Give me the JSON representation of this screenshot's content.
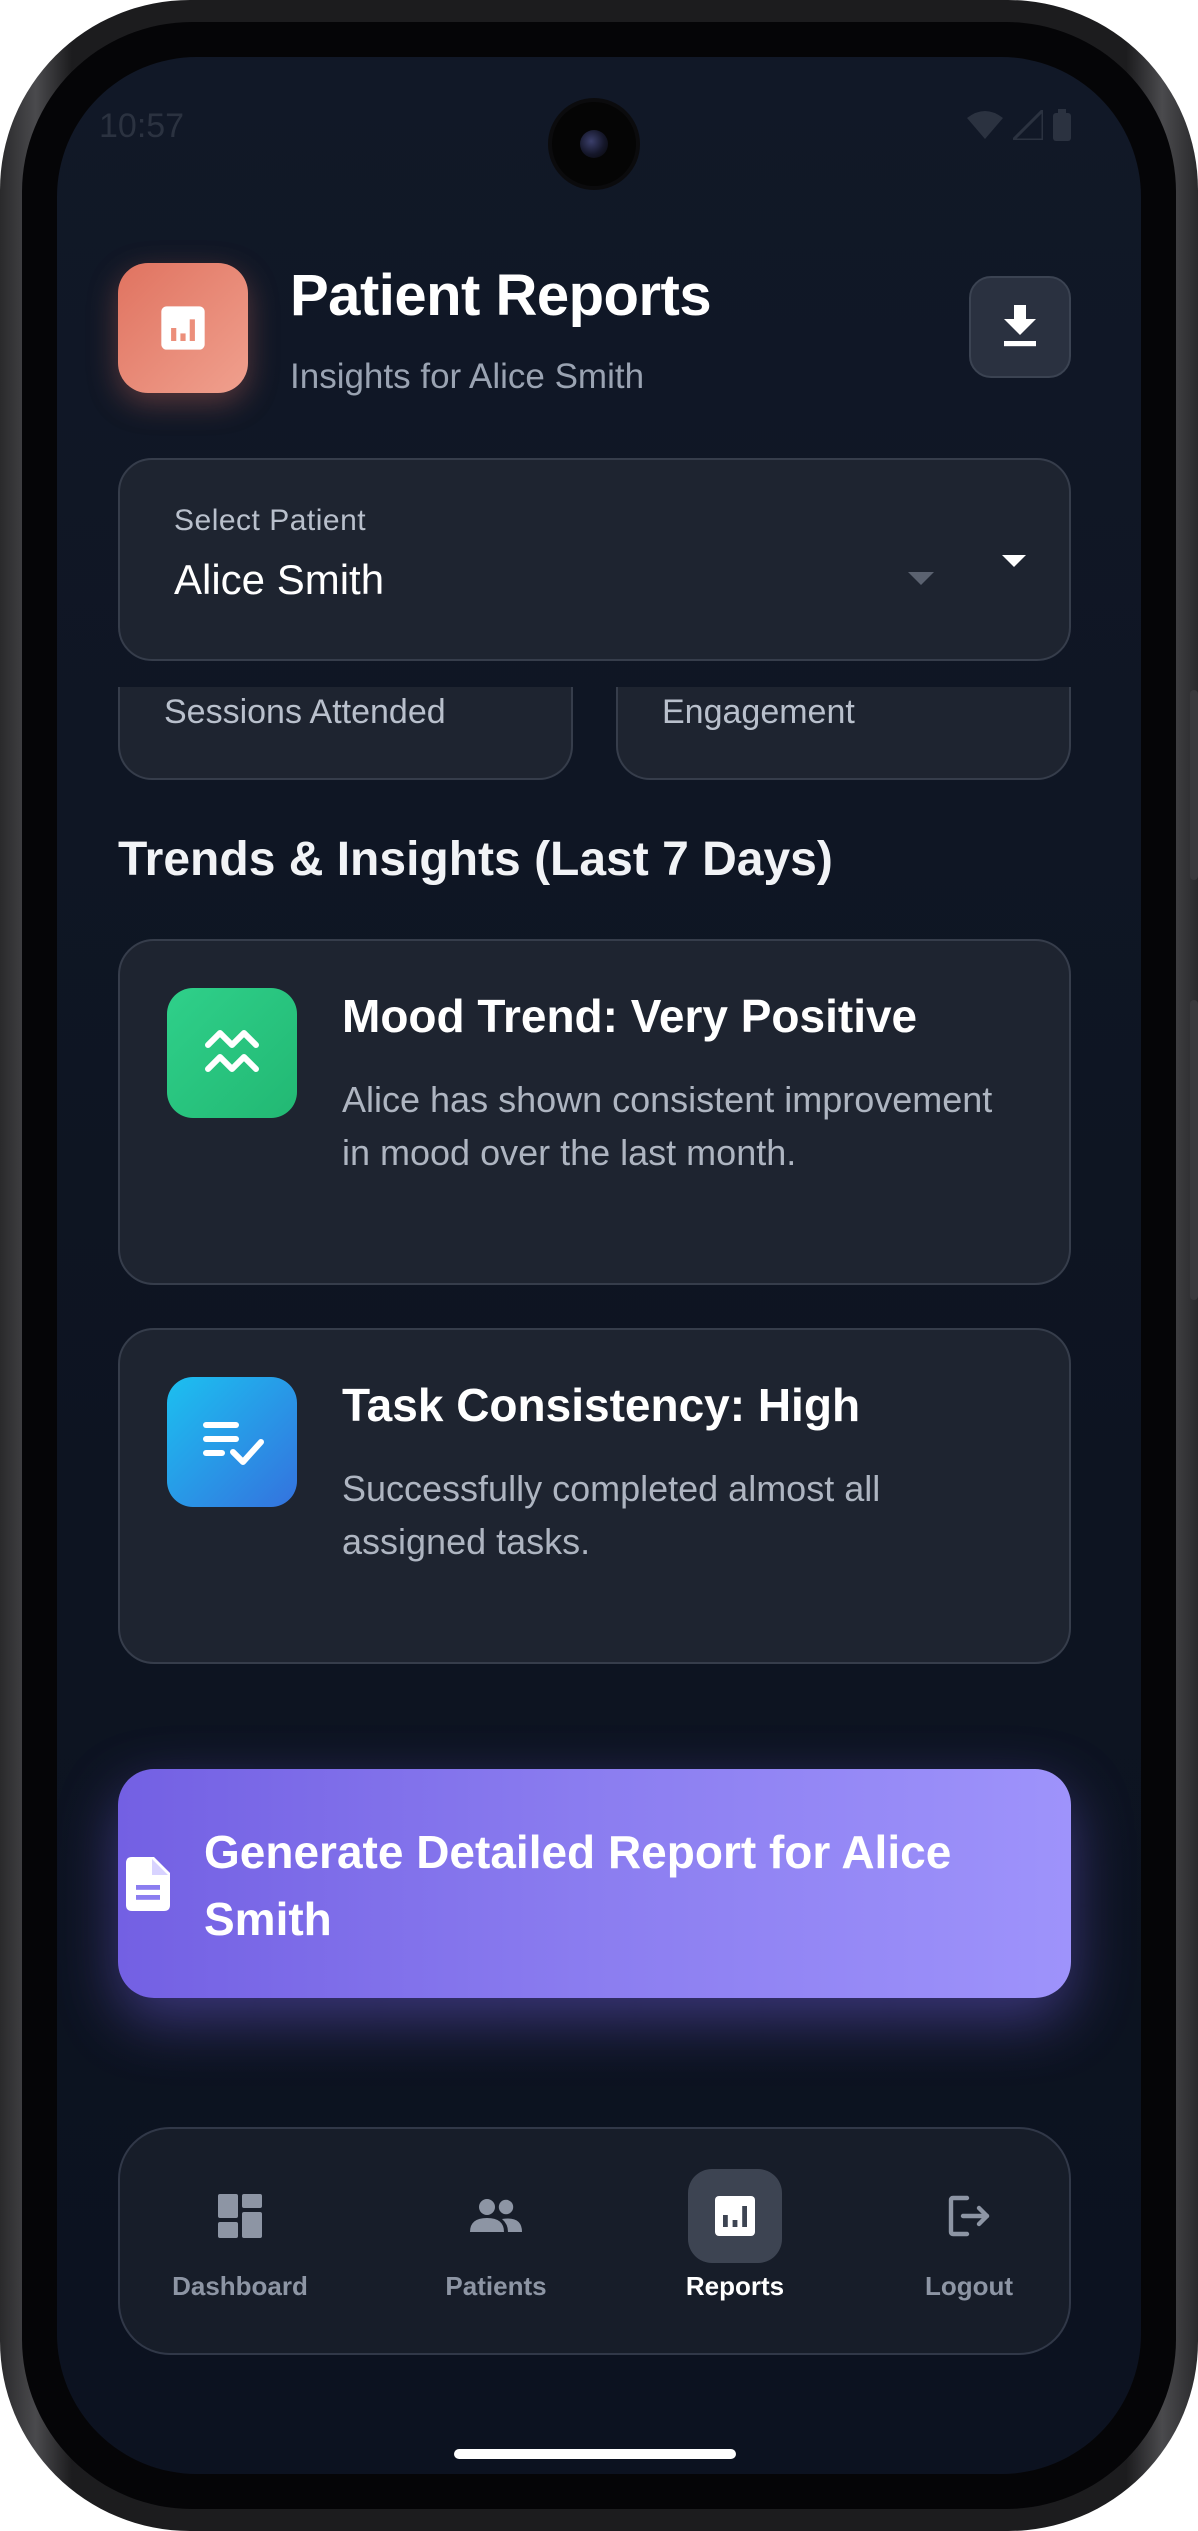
{
  "status_bar": {
    "time": "10:57"
  },
  "header": {
    "title": "Patient Reports",
    "subtitle": "Insights for Alice Smith",
    "icon": "report-chart-icon",
    "download_icon": "download-icon"
  },
  "patient_select": {
    "label": "Select Patient",
    "value": "Alice Smith"
  },
  "stats": [
    {
      "label": "Sessions Attended"
    },
    {
      "label": "Engagement"
    }
  ],
  "trends": {
    "section_title": "Trends & Insights (Last 7 Days)",
    "cards": [
      {
        "title": "Mood Trend: Very Positive",
        "text": "Alice has shown consistent improvement in mood over the last month.",
        "icon": "trend-waves-icon",
        "color": "#2ecc82"
      },
      {
        "title": "Task Consistency: High",
        "text": "Successfully completed almost all assigned tasks.",
        "icon": "checklist-icon",
        "color": "#2da8f0"
      }
    ]
  },
  "generate_button": {
    "label": "Generate Detailed Report for Alice Smith",
    "icon": "document-icon"
  },
  "bottom_nav": {
    "active": "Reports",
    "items": [
      {
        "label": "Dashboard",
        "icon": "dashboard-icon"
      },
      {
        "label": "Patients",
        "icon": "people-icon"
      },
      {
        "label": "Reports",
        "icon": "report-chart-icon"
      },
      {
        "label": "Logout",
        "icon": "logout-icon"
      }
    ]
  },
  "colors": {
    "background": "#111827",
    "card": "#1e2430",
    "accent_primary": "#8b7df0",
    "accent_header_icon": "#e8826f"
  }
}
